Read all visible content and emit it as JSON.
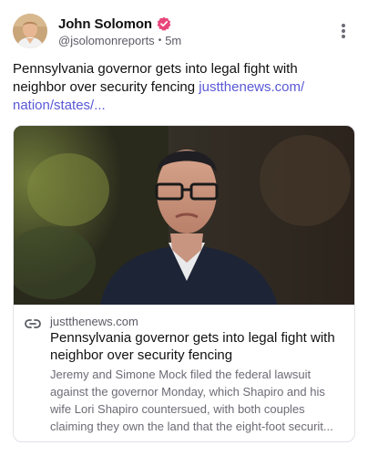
{
  "post": {
    "author": {
      "name": "John Solomon",
      "handle": "@jsolomonreports",
      "time": "5m"
    },
    "text": "Pennsylvania governor gets into legal fight with neighbor over security fencing",
    "link_text": "justthenews.com/nation/states/...",
    "link_text_line1": "justthenews.com/",
    "link_text_line2": "nation/states/...",
    "card": {
      "domain": "justthenews.com",
      "title": "Pennsylvania governor gets into legal fight with neighbor over security fencing",
      "description": "Jeremy and Simone Mock filed the federal lawsuit against the governor Monday, which Shapiro and his wife Lori Shapiro countersued, with both couples claiming they own the land that the eight-foot securit...",
      "desc_line1": "Jeremy and Simone Mock filed the federal lawsuit",
      "desc_line2": "against the governor Monday, which Shapiro and his",
      "desc_line3": "wife Lori Shapiro countersued, with both couples",
      "desc_line4": "claiming they own the land that the eight-foot securit..."
    }
  },
  "icons": {
    "verified": "verified-badge-icon",
    "more": "more-vertical-icon",
    "link": "link-icon"
  },
  "colors": {
    "link": "#5a59d6",
    "verified_badge": "#e8467a",
    "muted_text": "#5b5b66"
  }
}
